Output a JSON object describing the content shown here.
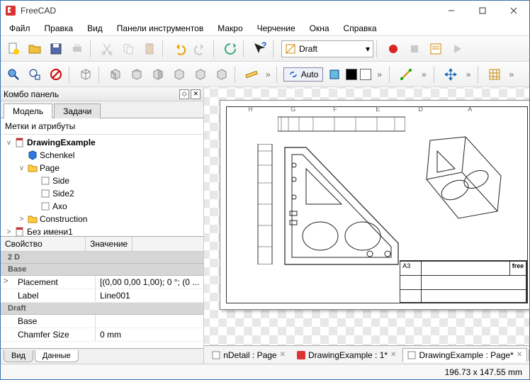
{
  "window": {
    "title": "FreeCAD"
  },
  "menu": [
    "Файл",
    "Правка",
    "Вид",
    "Панели инструментов",
    "Макро",
    "Черчение",
    "Окна",
    "Справка"
  ],
  "draft_mode": "Draft",
  "auto_label": "Auto",
  "panel": {
    "title": "Комбо панель",
    "tabs": [
      "Модель",
      "Задачи"
    ],
    "tree_label": "Метки и атрибуты",
    "bottom_tabs": [
      "Вид",
      "Данные"
    ]
  },
  "tree": [
    {
      "exp": "v",
      "icon": "doc",
      "name": "DrawingExample",
      "bold": true,
      "indent": 0
    },
    {
      "exp": "",
      "icon": "cube-blue",
      "name": "Schenkel",
      "indent": 1
    },
    {
      "exp": "v",
      "icon": "folder",
      "name": "Page",
      "indent": 1
    },
    {
      "exp": "",
      "icon": "box",
      "name": "Side",
      "indent": 2
    },
    {
      "exp": "",
      "icon": "box",
      "name": "Side2",
      "indent": 2
    },
    {
      "exp": "",
      "icon": "box",
      "name": "Axo",
      "indent": 2
    },
    {
      "exp": ">",
      "icon": "folder",
      "name": "Construction",
      "indent": 1
    },
    {
      "exp": ">",
      "icon": "doc",
      "name": "Без имени1",
      "indent": 0
    }
  ],
  "props": {
    "headers": [
      "Свойство",
      "Значение"
    ],
    "groups": [
      {
        "name": "2 D",
        "rows": []
      },
      {
        "name": "Base",
        "rows": [
          {
            "exp": ">",
            "k": "Placement",
            "v": "[(0,00 0,00 1,00); 0 °; (0 ..."
          },
          {
            "exp": "",
            "k": "Label",
            "v": "Line001"
          }
        ]
      },
      {
        "name": "Draft",
        "rows": [
          {
            "exp": "",
            "k": "Base",
            "v": ""
          },
          {
            "exp": "",
            "k": "Chamfer Size",
            "v": "0 mm"
          }
        ]
      }
    ]
  },
  "doc_tabs": [
    {
      "icon": "page",
      "label": "nDetail : Page",
      "active": false
    },
    {
      "icon": "freecad",
      "label": "DrawingExample : 1*",
      "active": false
    },
    {
      "icon": "page",
      "label": "DrawingExample : Page*",
      "active": true
    }
  ],
  "titleblock": {
    "format": "A3",
    "brand": "free"
  },
  "ruler_letters": [
    "H",
    "G",
    "F",
    "E",
    "D",
    "A"
  ],
  "status": "196.73 x 147.55 mm"
}
